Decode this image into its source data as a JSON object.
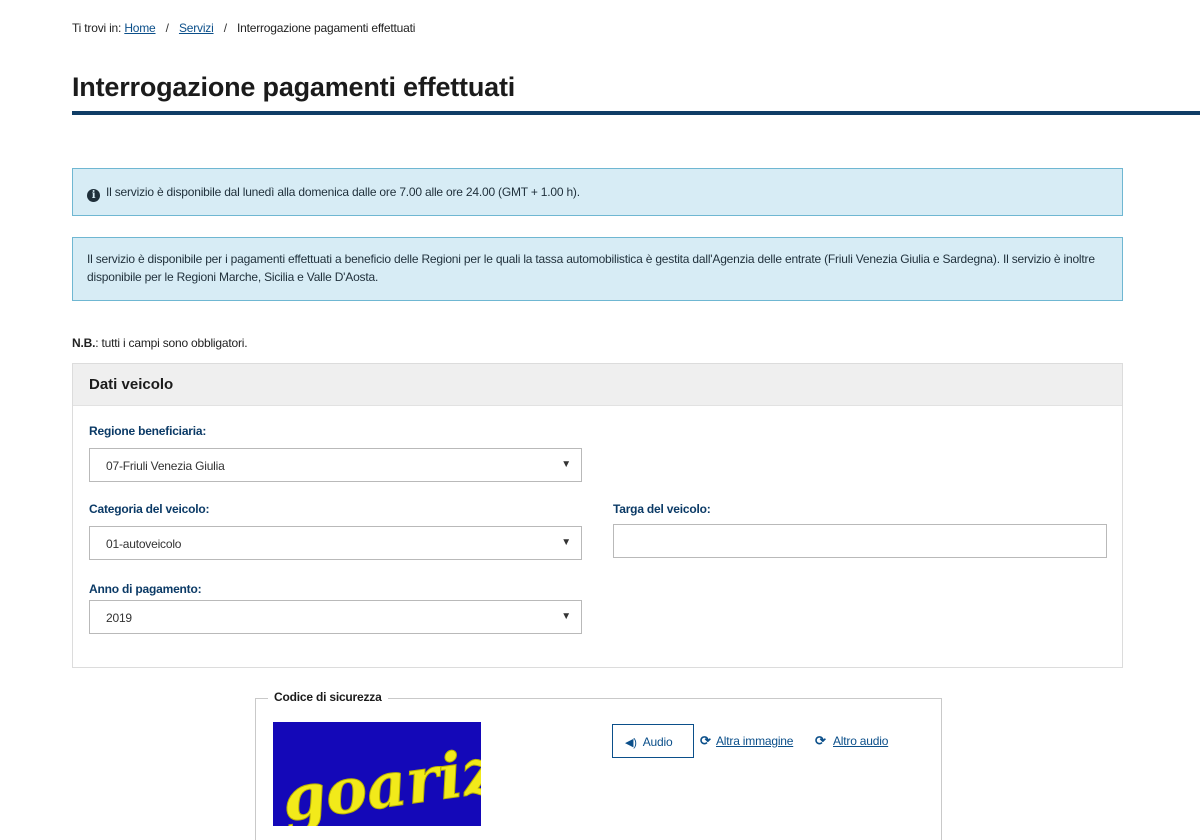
{
  "breadcrumb": {
    "prefix": "Ti trovi in:",
    "items": [
      {
        "label": "Home",
        "link": true
      },
      {
        "label": "Servizi",
        "link": true
      },
      {
        "label": "Interrogazione pagamenti effettuati",
        "link": false
      }
    ],
    "separator": "/"
  },
  "page": {
    "title": "Interrogazione pagamenti effettuati"
  },
  "alerts": {
    "availability": "Il servizio è disponibile dal lunedì alla domenica dalle ore 7.00 alle ore 24.00 (GMT + 1.00 h).",
    "regions": "Il servizio è disponibile per i pagamenti effettuati a beneficio delle Regioni per le quali la tassa automobilistica è gestita dall'Agenzia delle entrate (Friuli Venezia Giulia e Sardegna). Il servizio è inoltre disponibile per le Regioni Marche, Sicilia e Valle D'Aosta.",
    "icon": "info-circle-icon"
  },
  "note": {
    "bold": "N.B.",
    "text": ": tutti i campi sono obbligatori."
  },
  "vehicle_panel": {
    "title": "Dati veicolo",
    "regione": {
      "label": "Regione beneficiaria:",
      "value": "07-Friuli Venezia Giulia"
    },
    "categoria": {
      "label": "Categoria del veicolo:",
      "value": "01-autoveicolo"
    },
    "targa": {
      "label": "Targa del veicolo:",
      "value": ""
    },
    "anno": {
      "label": "Anno di pagamento:",
      "value": "2019"
    },
    "caret": "▼"
  },
  "captcha": {
    "legend": "Codice di sicurezza",
    "image_text": "goarizu",
    "audio_label": "Audio",
    "other_image": "Altra immagine",
    "other_audio": "Altro audio",
    "colors": {
      "background": "#1408b8",
      "text": "#f2ea1a"
    }
  },
  "colors": {
    "accent": "#0f3d66",
    "link": "#0b4f8a",
    "alert_bg": "#d7ecf5",
    "alert_border": "#6fb7d2"
  }
}
